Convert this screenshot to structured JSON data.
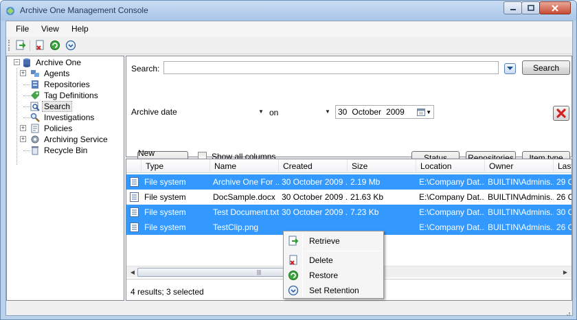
{
  "window": {
    "title": "Archive One Management Console"
  },
  "menu": [
    "File",
    "View",
    "Help"
  ],
  "toolbar": {
    "icons": [
      "export-icon",
      "delete-icon",
      "restore-icon",
      "retention-icon"
    ]
  },
  "tree": {
    "root": "Archive One",
    "items": [
      "Agents",
      "Repositories",
      "Tag Definitions",
      "Search",
      "Investigations",
      "Policies",
      "Archiving Service",
      "Recycle Bin"
    ]
  },
  "search": {
    "label": "Search:",
    "query": "",
    "search_button": "Search",
    "criterion_field": "Archive date",
    "operator": "on",
    "date_day": "30",
    "date_month": "October",
    "date_year": "2009",
    "new_criterion_button": "New Criterion",
    "show_all_columns": "Show all columns",
    "status_button": "Status",
    "repositories_button": "Repositories",
    "item_type_button": "Item type"
  },
  "results": {
    "columns": [
      "Type",
      "Name",
      "Created",
      "Size",
      "Location",
      "Owner",
      "Last"
    ],
    "rows": [
      {
        "type": "File system",
        "name": "Archive One For ...",
        "created": "30 October 2009 ...",
        "size": "2.19 Mb",
        "location": "E:\\Company Dat...",
        "owner": "BUILTIN\\Adminis...",
        "last": "29 Oc",
        "selected": true
      },
      {
        "type": "File system",
        "name": "DocSample.docx",
        "created": "30 October 2009 ...",
        "size": "21.63 Kb",
        "location": "E:\\Company Dat...",
        "owner": "BUILTIN\\Adminis...",
        "last": "26 Oc",
        "selected": false
      },
      {
        "type": "File system",
        "name": "Test Document.txt",
        "created": "30 October 2009 ...",
        "size": "7.23 Kb",
        "location": "E:\\Company Dat...",
        "owner": "BUILTIN\\Adminis...",
        "last": "30 Oc",
        "selected": true
      },
      {
        "type": "File system",
        "name": "TestClip.png",
        "created": "",
        "size": "",
        "location": "E:\\Company Dat...",
        "owner": "BUILTIN\\Adminis...",
        "last": "26 Oc",
        "selected": true
      }
    ],
    "status": "4 results; 3 selected"
  },
  "context_menu": {
    "items": [
      {
        "label": "Retrieve",
        "icon": "retrieve-icon"
      },
      {
        "label": "Delete",
        "icon": "delete-icon"
      },
      {
        "label": "Restore",
        "icon": "restore-icon"
      },
      {
        "label": "Set Retention",
        "icon": "retention-icon"
      }
    ]
  },
  "colors": {
    "selection": "#3399ff",
    "frame": "#b9d1ea"
  }
}
